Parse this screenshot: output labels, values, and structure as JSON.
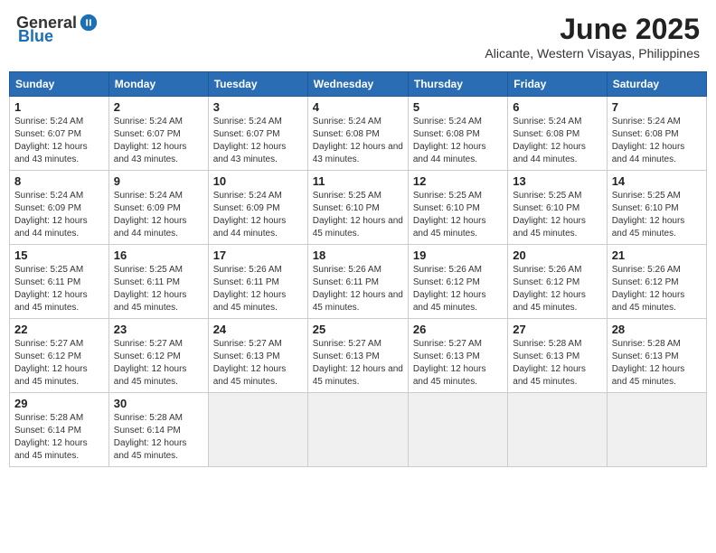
{
  "header": {
    "logo_general": "General",
    "logo_blue": "Blue",
    "month_year": "June 2025",
    "location": "Alicante, Western Visayas, Philippines"
  },
  "calendar": {
    "weekdays": [
      "Sunday",
      "Monday",
      "Tuesday",
      "Wednesday",
      "Thursday",
      "Friday",
      "Saturday"
    ],
    "rows": [
      [
        {
          "day": "1",
          "sunrise": "5:24 AM",
          "sunset": "6:07 PM",
          "daylight": "12 hours and 43 minutes."
        },
        {
          "day": "2",
          "sunrise": "5:24 AM",
          "sunset": "6:07 PM",
          "daylight": "12 hours and 43 minutes."
        },
        {
          "day": "3",
          "sunrise": "5:24 AM",
          "sunset": "6:07 PM",
          "daylight": "12 hours and 43 minutes."
        },
        {
          "day": "4",
          "sunrise": "5:24 AM",
          "sunset": "6:08 PM",
          "daylight": "12 hours and 43 minutes."
        },
        {
          "day": "5",
          "sunrise": "5:24 AM",
          "sunset": "6:08 PM",
          "daylight": "12 hours and 44 minutes."
        },
        {
          "day": "6",
          "sunrise": "5:24 AM",
          "sunset": "6:08 PM",
          "daylight": "12 hours and 44 minutes."
        },
        {
          "day": "7",
          "sunrise": "5:24 AM",
          "sunset": "6:08 PM",
          "daylight": "12 hours and 44 minutes."
        }
      ],
      [
        {
          "day": "8",
          "sunrise": "5:24 AM",
          "sunset": "6:09 PM",
          "daylight": "12 hours and 44 minutes."
        },
        {
          "day": "9",
          "sunrise": "5:24 AM",
          "sunset": "6:09 PM",
          "daylight": "12 hours and 44 minutes."
        },
        {
          "day": "10",
          "sunrise": "5:24 AM",
          "sunset": "6:09 PM",
          "daylight": "12 hours and 44 minutes."
        },
        {
          "day": "11",
          "sunrise": "5:25 AM",
          "sunset": "6:10 PM",
          "daylight": "12 hours and 45 minutes."
        },
        {
          "day": "12",
          "sunrise": "5:25 AM",
          "sunset": "6:10 PM",
          "daylight": "12 hours and 45 minutes."
        },
        {
          "day": "13",
          "sunrise": "5:25 AM",
          "sunset": "6:10 PM",
          "daylight": "12 hours and 45 minutes."
        },
        {
          "day": "14",
          "sunrise": "5:25 AM",
          "sunset": "6:10 PM",
          "daylight": "12 hours and 45 minutes."
        }
      ],
      [
        {
          "day": "15",
          "sunrise": "5:25 AM",
          "sunset": "6:11 PM",
          "daylight": "12 hours and 45 minutes."
        },
        {
          "day": "16",
          "sunrise": "5:25 AM",
          "sunset": "6:11 PM",
          "daylight": "12 hours and 45 minutes."
        },
        {
          "day": "17",
          "sunrise": "5:26 AM",
          "sunset": "6:11 PM",
          "daylight": "12 hours and 45 minutes."
        },
        {
          "day": "18",
          "sunrise": "5:26 AM",
          "sunset": "6:11 PM",
          "daylight": "12 hours and 45 minutes."
        },
        {
          "day": "19",
          "sunrise": "5:26 AM",
          "sunset": "6:12 PM",
          "daylight": "12 hours and 45 minutes."
        },
        {
          "day": "20",
          "sunrise": "5:26 AM",
          "sunset": "6:12 PM",
          "daylight": "12 hours and 45 minutes."
        },
        {
          "day": "21",
          "sunrise": "5:26 AM",
          "sunset": "6:12 PM",
          "daylight": "12 hours and 45 minutes."
        }
      ],
      [
        {
          "day": "22",
          "sunrise": "5:27 AM",
          "sunset": "6:12 PM",
          "daylight": "12 hours and 45 minutes."
        },
        {
          "day": "23",
          "sunrise": "5:27 AM",
          "sunset": "6:12 PM",
          "daylight": "12 hours and 45 minutes."
        },
        {
          "day": "24",
          "sunrise": "5:27 AM",
          "sunset": "6:13 PM",
          "daylight": "12 hours and 45 minutes."
        },
        {
          "day": "25",
          "sunrise": "5:27 AM",
          "sunset": "6:13 PM",
          "daylight": "12 hours and 45 minutes."
        },
        {
          "day": "26",
          "sunrise": "5:27 AM",
          "sunset": "6:13 PM",
          "daylight": "12 hours and 45 minutes."
        },
        {
          "day": "27",
          "sunrise": "5:28 AM",
          "sunset": "6:13 PM",
          "daylight": "12 hours and 45 minutes."
        },
        {
          "day": "28",
          "sunrise": "5:28 AM",
          "sunset": "6:13 PM",
          "daylight": "12 hours and 45 minutes."
        }
      ],
      [
        {
          "day": "29",
          "sunrise": "5:28 AM",
          "sunset": "6:14 PM",
          "daylight": "12 hours and 45 minutes."
        },
        {
          "day": "30",
          "sunrise": "5:28 AM",
          "sunset": "6:14 PM",
          "daylight": "12 hours and 45 minutes."
        },
        null,
        null,
        null,
        null,
        null
      ]
    ]
  }
}
